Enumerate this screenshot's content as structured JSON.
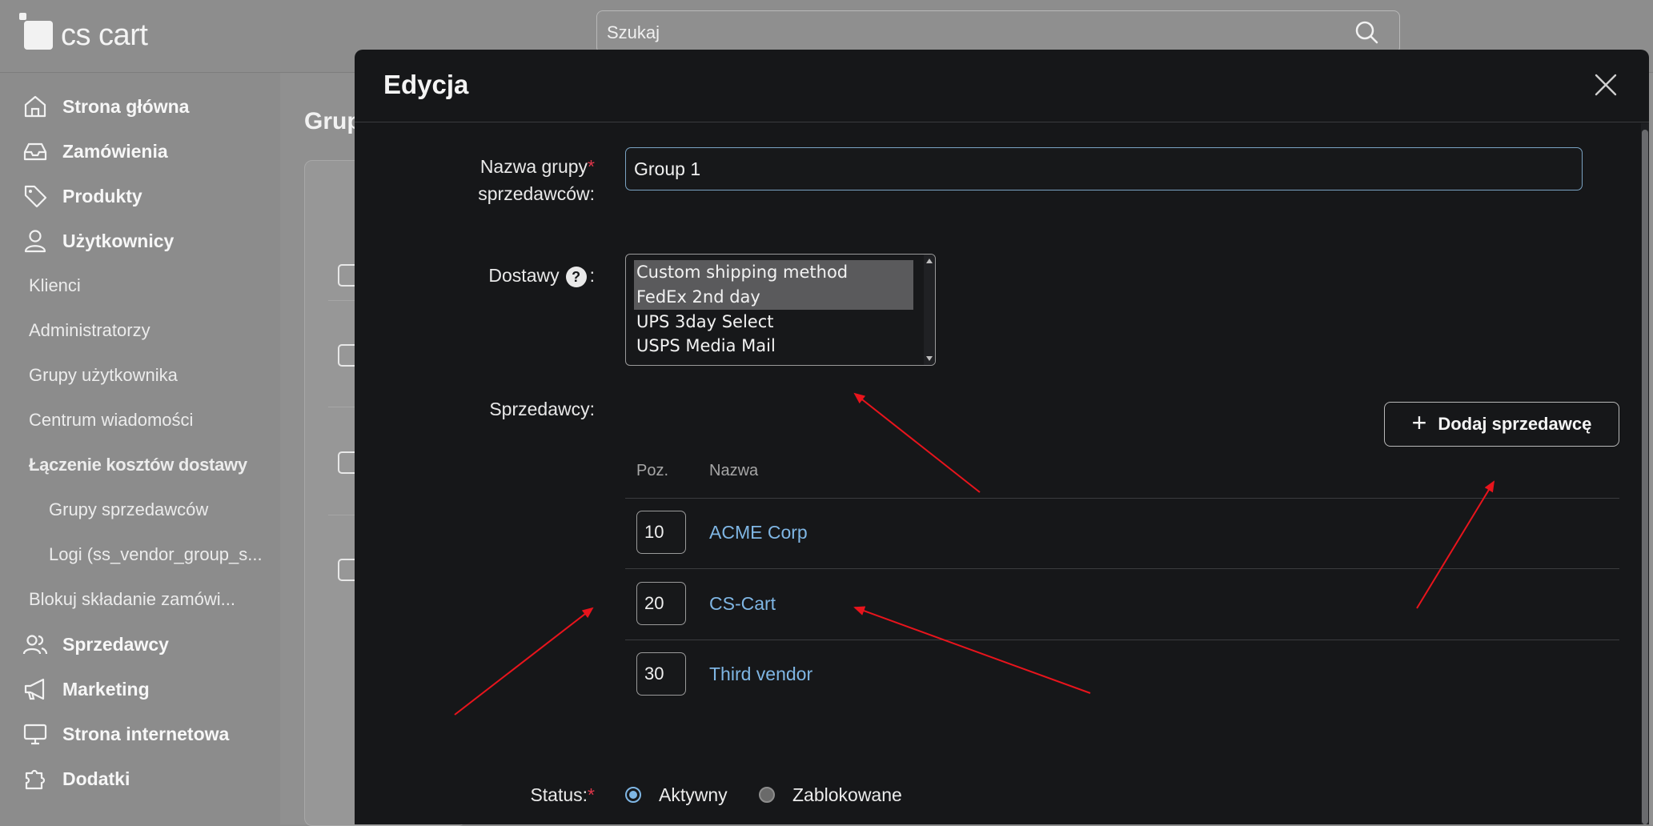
{
  "app": {
    "logo_text": "cs cart",
    "search_placeholder": "Szukaj"
  },
  "sidebar": {
    "items": [
      {
        "label": "Strona główna",
        "icon": "home-icon"
      },
      {
        "label": "Zamówienia",
        "icon": "inbox-icon"
      },
      {
        "label": "Produkty",
        "icon": "tag-icon"
      },
      {
        "label": "Użytkownicy",
        "icon": "user-icon"
      }
    ],
    "users_sub": [
      "Klienci",
      "Administratorzy",
      "Grupy użytkownika",
      "Centrum wiadomości"
    ],
    "shipping_merge": "Łączenie kosztów dostawy",
    "shipping_merge_sub": [
      "Grupy sprzedawców",
      "Logi (ss_vendor_group_s..."
    ],
    "block_orders": "Blokuj składanie zamówi...",
    "items2": [
      {
        "label": "Sprzedawcy",
        "icon": "users-icon"
      },
      {
        "label": "Marketing",
        "icon": "megaphone-icon"
      },
      {
        "label": "Strona internetowa",
        "icon": "monitor-icon"
      },
      {
        "label": "Dodatki",
        "icon": "puzzle-icon"
      }
    ]
  },
  "background": {
    "page_title_fragment": "Grup"
  },
  "modal": {
    "title": "Edycja",
    "name_label_line1": "Nazwa grupy",
    "name_label_line2": "sprzedawców:",
    "required_mark": "*",
    "name_value": "Group 1",
    "shipping_label": "Dostawy",
    "help_mark": "?",
    "colon": ":",
    "shipping_options": [
      {
        "label": "Custom shipping method",
        "selected": true
      },
      {
        "label": "FedEx 2nd day",
        "selected": true
      },
      {
        "label": "UPS 3day Select",
        "selected": false
      },
      {
        "label": "USPS Media Mail",
        "selected": false
      }
    ],
    "vendors_label": "Sprzedawcy:",
    "add_vendor_button": "Dodaj sprzedawcę",
    "add_vendor_plus": "+",
    "table_headers": {
      "pos": "Poz.",
      "name": "Nazwa"
    },
    "vendors": [
      {
        "pos": "10",
        "name": "ACME Corp"
      },
      {
        "pos": "20",
        "name": "CS-Cart"
      },
      {
        "pos": "30",
        "name": "Third vendor"
      }
    ],
    "status_label": "Status:",
    "status_options": [
      {
        "label": "Aktywny",
        "selected": true
      },
      {
        "label": "Zablokowane",
        "selected": false
      }
    ]
  },
  "colors": {
    "accent_link": "#7fb6e4",
    "required": "#e0364a",
    "annotation_arrow": "#e8141c"
  }
}
